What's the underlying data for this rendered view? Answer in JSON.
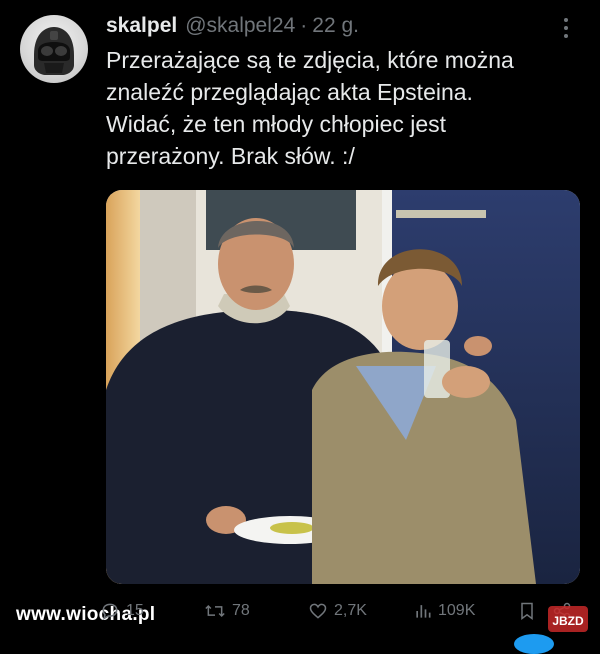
{
  "tweet": {
    "display_name": "skalpel",
    "handle": "@skalpel24",
    "separator": "·",
    "time": "22 g.",
    "text": "Przerażające są te zdjęcia, które można\nznaleźć przeglądając akta Epsteina.\nWidać, że ten młody chłopiec jest\nprzerażony. Brak słów. :/"
  },
  "actions": {
    "replies": "15",
    "retweets": "78",
    "likes": "2,7K",
    "views": "109K"
  },
  "watermark": {
    "site": "www.wiocha.pl",
    "logo_text": "JBZD"
  },
  "colors": {
    "background": "#000000",
    "text": "#e7e9ea",
    "muted": "#71767b",
    "accent": "#1d9bf0"
  },
  "icons": {
    "more": "more-vertical-icon",
    "reply": "reply-icon",
    "retweet": "retweet-icon",
    "like": "heart-icon",
    "views": "views-icon",
    "bookmark": "bookmark-icon",
    "share": "share-icon"
  }
}
